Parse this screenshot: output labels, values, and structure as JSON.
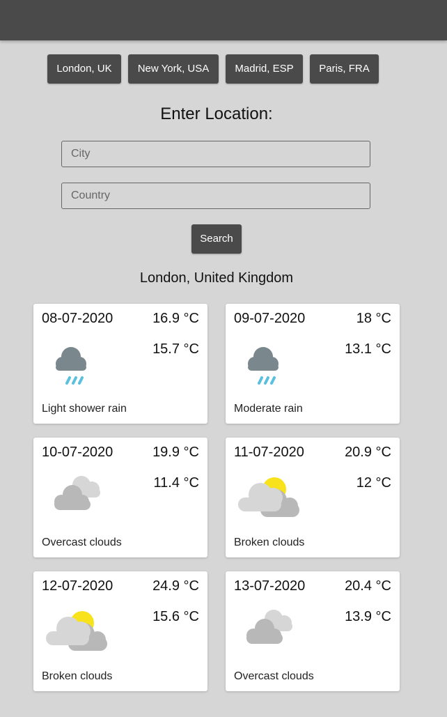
{
  "presets": [
    "London, UK",
    "New York, USA",
    "Madrid, ESP",
    "Paris, FRA"
  ],
  "form": {
    "title": "Enter Location:",
    "city_placeholder": "City",
    "country_placeholder": "Country",
    "search_label": "Search"
  },
  "location": "London, United Kingdom",
  "forecast": [
    {
      "date": "08-07-2020",
      "max": "16.9 °C",
      "min": "15.7 °C",
      "desc": "Light shower rain",
      "icon": "rain-icon"
    },
    {
      "date": "09-07-2020",
      "max": "18 °C",
      "min": "13.1 °C",
      "desc": "Moderate rain",
      "icon": "rain-icon"
    },
    {
      "date": "10-07-2020",
      "max": "19.9 °C",
      "min": "11.4 °C",
      "desc": "Overcast clouds",
      "icon": "overcast-clouds-icon"
    },
    {
      "date": "11-07-2020",
      "max": "20.9 °C",
      "min": "12 °C",
      "desc": "Broken clouds",
      "icon": "broken-clouds-icon"
    },
    {
      "date": "12-07-2020",
      "max": "24.9 °C",
      "min": "15.6 °C",
      "desc": "Broken clouds",
      "icon": "broken-clouds-icon"
    },
    {
      "date": "13-07-2020",
      "max": "20.4 °C",
      "min": "13.9 °C",
      "desc": "Overcast clouds",
      "icon": "overcast-clouds-icon"
    }
  ],
  "colors": {
    "header": "#4a4a4a",
    "background": "#d6d6d6",
    "rain_cloud": "#7a878d",
    "rain_drop": "#5bc0de",
    "sun": "#f7e21c",
    "light_cloud": "#d6d6d6",
    "dark_cloud": "#b8b8b8"
  }
}
